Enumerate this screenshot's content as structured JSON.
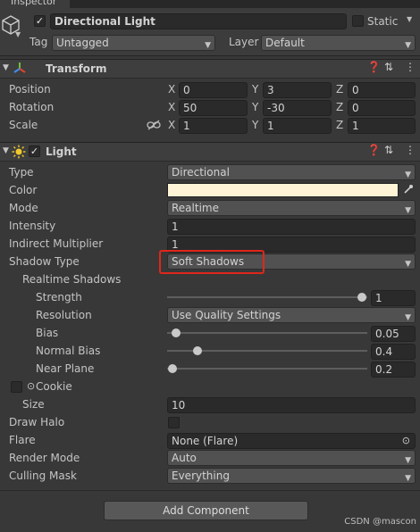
{
  "window": {
    "tab_title": "Inspector"
  },
  "object": {
    "name": "Directional Light",
    "enabled": true,
    "static_label": "Static",
    "tag_label": "Tag",
    "tag_value": "Untagged",
    "layer_label": "Layer",
    "layer_value": "Default"
  },
  "transform": {
    "title": "Transform",
    "position_label": "Position",
    "rotation_label": "Rotation",
    "scale_label": "Scale",
    "axis_x": "X",
    "axis_y": "Y",
    "axis_z": "Z",
    "position": {
      "x": "0",
      "y": "3",
      "z": "0"
    },
    "rotation": {
      "x": "50",
      "y": "-30",
      "z": "0"
    },
    "scale": {
      "x": "1",
      "y": "1",
      "z": "1"
    }
  },
  "light": {
    "title": "Light",
    "enabled": true,
    "type_label": "Type",
    "type_value": "Directional",
    "color_label": "Color",
    "color_value": "#fff4d6",
    "mode_label": "Mode",
    "mode_value": "Realtime",
    "intensity_label": "Intensity",
    "intensity_value": "1",
    "indirect_label": "Indirect Multiplier",
    "indirect_value": "1",
    "shadow_type_label": "Shadow Type",
    "shadow_type_value": "Soft Shadows",
    "realtime_shadows_label": "Realtime Shadows",
    "strength_label": "Strength",
    "strength_value": "1",
    "resolution_label": "Resolution",
    "resolution_value": "Use Quality Settings",
    "bias_label": "Bias",
    "bias_value": "0.05",
    "normal_bias_label": "Normal Bias",
    "normal_bias_value": "0.4",
    "near_plane_label": "Near Plane",
    "near_plane_value": "0.2",
    "cookie_label": "Cookie",
    "size_label": "Size",
    "size_value": "10",
    "draw_halo_label": "Draw Halo",
    "flare_label": "Flare",
    "flare_value": "None (Flare)",
    "render_mode_label": "Render Mode",
    "render_mode_value": "Auto",
    "culling_mask_label": "Culling Mask",
    "culling_mask_value": "Everything"
  },
  "add_component_label": "Add Component",
  "watermark": "CSDN @mascon"
}
